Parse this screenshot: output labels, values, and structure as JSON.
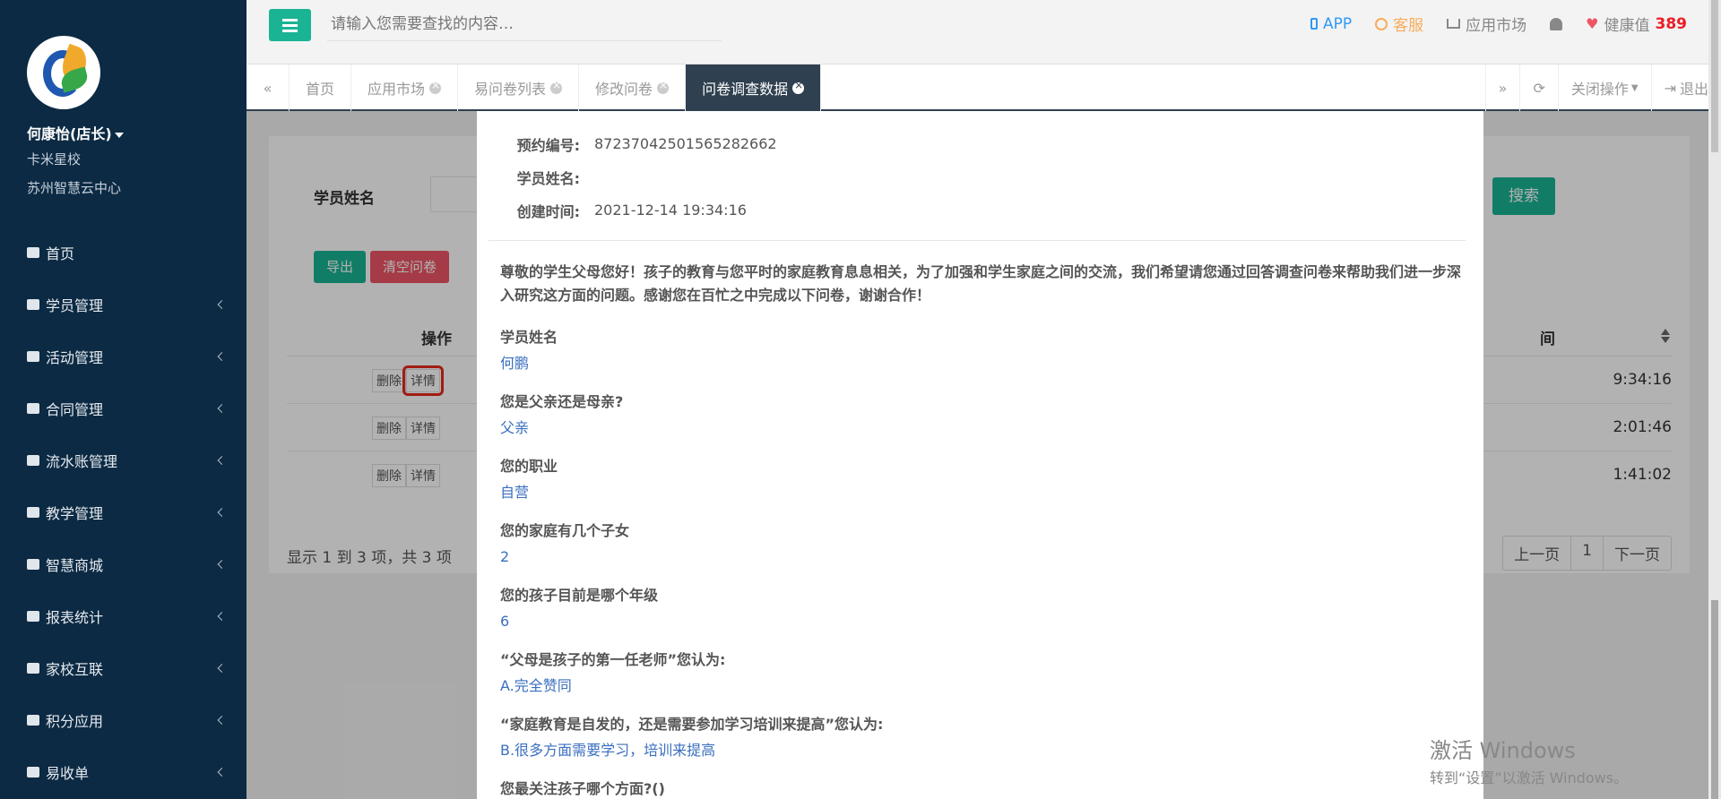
{
  "sidebar": {
    "user_name": "何康怡(店长)",
    "school": "卡米星校",
    "center": "苏州智慧云中心",
    "items": [
      {
        "label": "首页",
        "icon": "home-icon"
      },
      {
        "label": "学员管理",
        "icon": "users-icon"
      },
      {
        "label": "活动管理",
        "icon": "map-icon"
      },
      {
        "label": "合同管理",
        "icon": "cart-icon"
      },
      {
        "label": "流水账管理",
        "icon": "exchange-icon"
      },
      {
        "label": "教学管理",
        "icon": "calendar-icon"
      },
      {
        "label": "智慧商城",
        "icon": "inbox-icon"
      },
      {
        "label": "报表统计",
        "icon": "bar-chart-icon"
      },
      {
        "label": "家校互联",
        "icon": "comments-icon"
      },
      {
        "label": "积分应用",
        "icon": "inbox-icon"
      },
      {
        "label": "易收单",
        "icon": "user-plus-icon"
      }
    ]
  },
  "topbar": {
    "search_placeholder": "请输入您需要查找的内容…",
    "app": "APP",
    "service": "客服",
    "market": "应用市场",
    "health_label": "健康值",
    "health_value": "389"
  },
  "tabs": [
    {
      "label": "首页"
    },
    {
      "label": "应用市场"
    },
    {
      "label": "易问卷列表"
    },
    {
      "label": "修改问卷"
    },
    {
      "label": "问卷调查数据"
    }
  ],
  "tab_actions": {
    "close_ops": "关闭操作",
    "logout": "退出"
  },
  "background": {
    "filter_label": "学员姓名",
    "search_btn": "搜索",
    "export_btn": "导出",
    "clear_btn": "清空问卷",
    "col_op": "操作",
    "col_time": "间",
    "delete": "删除",
    "detail": "详情",
    "times": [
      "9:34:16",
      "2:01:46",
      "1:41:02"
    ],
    "footer": "显示 1 到 3 项，共 3 项",
    "prev": "上一页",
    "page": "1",
    "next": "下一页"
  },
  "modal": {
    "meta": [
      {
        "key": "预约编号:",
        "value": "87237042501565282662"
      },
      {
        "key": "学员姓名:",
        "value": ""
      },
      {
        "key": "创建时间:",
        "value": "2021-12-14 19:34:16"
      }
    ],
    "intro": "尊敬的学生父母您好！孩子的教育与您平时的家庭教育息息相关，为了加强和学生家庭之间的交流，我们希望请您通过回答调查问卷来帮助我们进一步深入研究这方面的问题。感谢您在百忙之中完成以下问卷，谢谢合作！",
    "qa": [
      {
        "q": "学员姓名",
        "a": "何鹏"
      },
      {
        "q": "您是父亲还是母亲?",
        "a": "父亲"
      },
      {
        "q": "您的职业",
        "a": "自营"
      },
      {
        "q": "您的家庭有几个子女",
        "a": "2"
      },
      {
        "q": "您的孩子目前是哪个年级",
        "a": "6"
      },
      {
        "q": "“父母是孩子的第一任老师”您认为:",
        "a": "A.完全赞同"
      },
      {
        "q": "“家庭教育是自发的，还是需要参加学习培训来提高”您认为:",
        "a": "B.很多方面需要学习，培训来提高"
      },
      {
        "q": "您最关注孩子哪个方面?()",
        "a": ""
      }
    ]
  },
  "watermark": {
    "line1": "激活 Windows",
    "line2": "转到“设置”以激活 Windows。"
  }
}
